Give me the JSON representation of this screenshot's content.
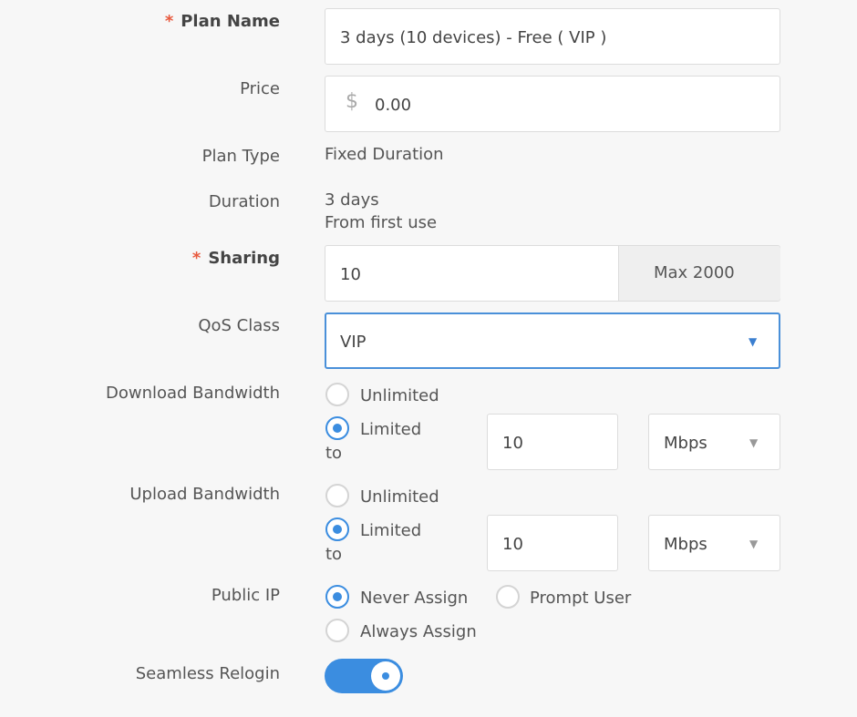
{
  "plan_name": {
    "label": "Plan Name",
    "required_mark": "*",
    "value": "3 days (10 devices) - Free ( VIP )"
  },
  "price": {
    "label": "Price",
    "currency": "$",
    "value": "0.00"
  },
  "plan_type": {
    "label": "Plan Type",
    "value": "Fixed Duration"
  },
  "duration": {
    "label": "Duration",
    "value_line1": "3 days",
    "value_line2": "From first use"
  },
  "sharing": {
    "label": "Sharing",
    "required_mark": "*",
    "value": "10",
    "max_text": "Max 2000"
  },
  "qos_class": {
    "label": "QoS Class",
    "selected": "VIP"
  },
  "download_bandwidth": {
    "label": "Download Bandwidth",
    "option_unlimited": "Unlimited",
    "option_limited": "Limited",
    "to_text": "to",
    "selected": "Limited",
    "value": "10",
    "unit": "Mbps"
  },
  "upload_bandwidth": {
    "label": "Upload Bandwidth",
    "option_unlimited": "Unlimited",
    "option_limited": "Limited",
    "to_text": "to",
    "selected": "Limited",
    "value": "10",
    "unit": "Mbps"
  },
  "public_ip": {
    "label": "Public IP",
    "option_never": "Never Assign",
    "option_prompt": "Prompt User",
    "option_always": "Always Assign",
    "selected": "Never Assign"
  },
  "seamless_relogin": {
    "label": "Seamless Relogin",
    "enabled": true
  },
  "colors": {
    "accent": "#3b8de0",
    "required": "#e8593d",
    "background": "#f7f7f7"
  },
  "icons": {
    "select_caret": "caret-down-icon",
    "radio": "radio-icon",
    "toggle": "toggle-switch"
  }
}
